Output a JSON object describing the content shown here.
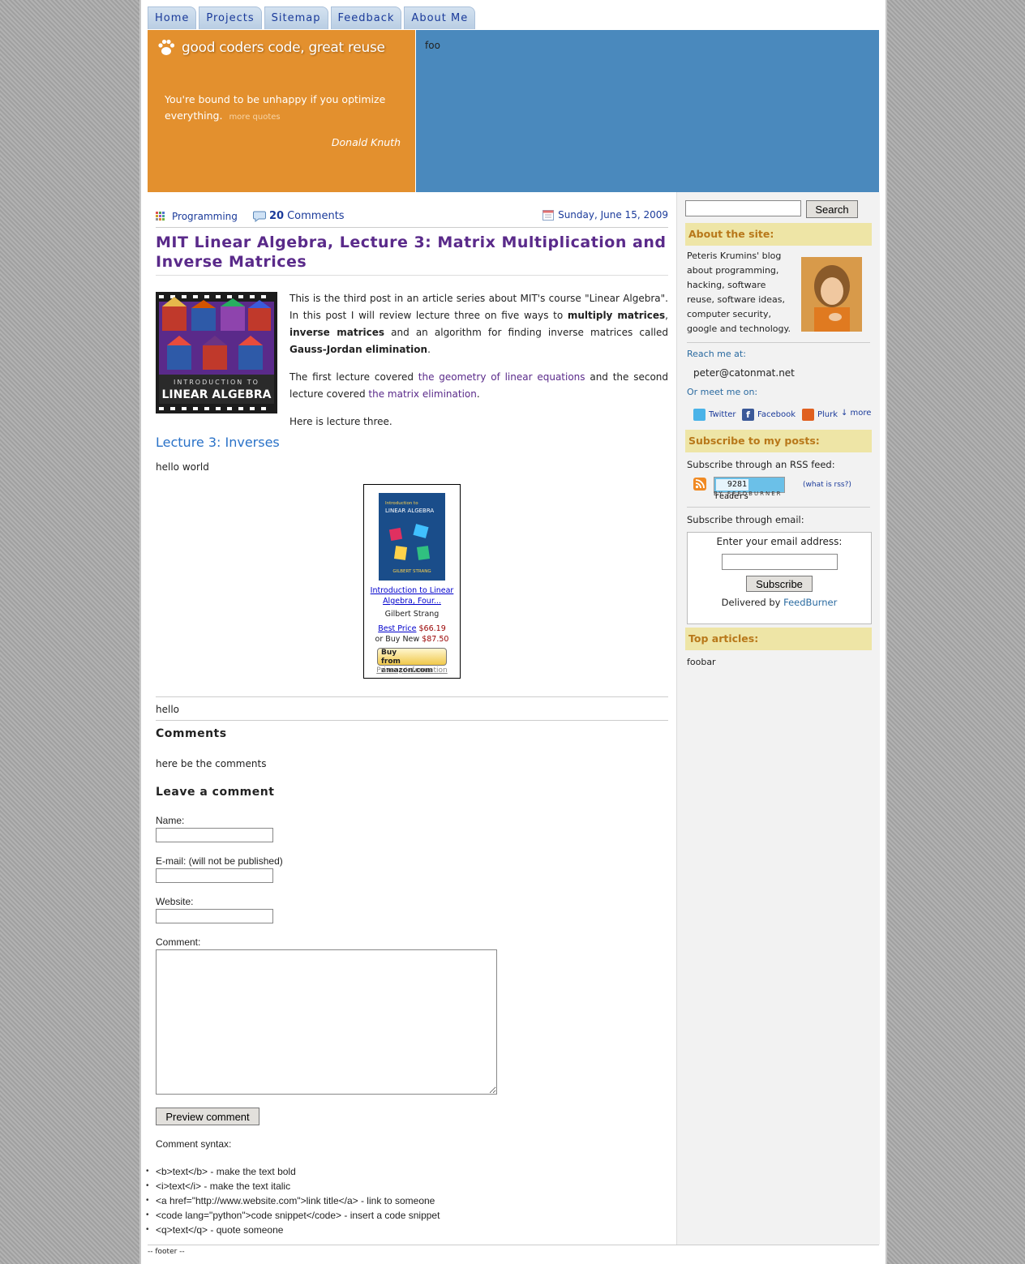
{
  "nav": {
    "tabs": [
      "Home",
      "Projects",
      "Sitemap",
      "Feedback",
      "About Me"
    ]
  },
  "header": {
    "logo_text": "good coders code, great reuse",
    "quote": "You're bound to be unhappy if you optimize everything.",
    "more_quotes": "more quotes",
    "quote_author": "Donald Knuth",
    "right_text": "foo"
  },
  "post": {
    "category": "Programming",
    "comment_count": "20",
    "comments_label": "Comments",
    "date": "Sunday, June 15, 2009",
    "title": "MIT Linear Algebra, Lecture 3: Matrix Multiplication and Inverse Matrices",
    "book_cover_line1": "INTRODUCTION TO",
    "book_cover_line2": "LINEAR ALGEBRA",
    "p1_a": "This is the third post in an article series about MIT's course \"Linear Algebra\". In this post I will review lecture three on five ways to ",
    "p1_b1": "multiply matrices",
    "p1_c": ", ",
    "p1_b2": "inverse matrices",
    "p1_d": " and an algorithm for finding inverse matrices called ",
    "p1_b3": "Gauss-Jordan elimination",
    "p1_e": ".",
    "p2_a": "The first lecture covered ",
    "p2_link1": "the geometry of linear equations",
    "p2_b": " and the second lecture covered ",
    "p2_link2": "the matrix elimination",
    "p2_c": ".",
    "p3": "Here is lecture three.",
    "lecture_heading": "Lecture 3: Inverses",
    "hello_world": "hello world",
    "after_box": "hello"
  },
  "amazon": {
    "cover_line1": "Introduction to",
    "cover_line2": "LINEAR ALGEBRA",
    "cover_author": "GILBERT STRANG",
    "title": "Introduction to Linear Algebra, Four...",
    "author": "Gilbert Strang",
    "best_price_label": "Best Price",
    "best_price": "$66.19",
    "buy_new_label": "or Buy New",
    "buy_new_price": "$87.50",
    "buy_button_line1": "Buy",
    "buy_button_line2": "from",
    "buy_button_brand": "amazon.com",
    "privacy": "Privacy Information"
  },
  "comments": {
    "heading": "Comments",
    "text": "here be the comments",
    "leave_heading": "Leave a comment",
    "name_label": "Name:",
    "email_label": "E-mail: (will not be published)",
    "website_label": "Website:",
    "comment_label": "Comment:",
    "preview_button": "Preview comment",
    "syntax_label": "Comment syntax:",
    "syntax": [
      "<b>text</b> - make the text bold",
      "<i>text</i> - make the text italic",
      "<a href=\"http://www.website.com\">link title</a> - link to someone",
      "<code lang=\"python\">code snippet</code> - insert a code snippet",
      "<q>text</q> - quote someone"
    ]
  },
  "sidebar": {
    "search_button": "Search",
    "about_heading": "About the site:",
    "about_lines": [
      "Peteris Krumins' blog",
      "about programming,",
      "hacking, software",
      "reuse, software ideas,",
      "computer security,",
      "google and technology."
    ],
    "reach_label": "Reach me at:",
    "email": "peter@catonmat.net",
    "meet_label": "Or meet me on:",
    "twitter": "Twitter",
    "facebook": "Facebook",
    "plurk": "Plurk",
    "more": "↓ more",
    "subscribe_heading": "Subscribe to my posts:",
    "rss_label": "Subscribe through an RSS feed:",
    "readers_count": "9281",
    "readers_label": "readers",
    "by_feedburner": "BY FEEDBURNER",
    "what_is_rss": "(what is rss?)",
    "email_sub_label": "Subscribe through email:",
    "enter_email": "Enter your email address:",
    "subscribe_button": "Subscribe",
    "delivered_by": "Delivered by",
    "feedburner": "FeedBurner",
    "top_heading": "Top articles:",
    "top_text": "foobar"
  },
  "footer": {
    "text": "-- footer --"
  },
  "colors": {
    "header_orange": "#e3902e",
    "header_blue": "#4a89bd",
    "title_purple": "#5a2a8a",
    "link_blue": "#1a3a9a",
    "sidebar_heading_bg": "#eee5a6",
    "sidebar_heading_text": "#b8781a"
  }
}
